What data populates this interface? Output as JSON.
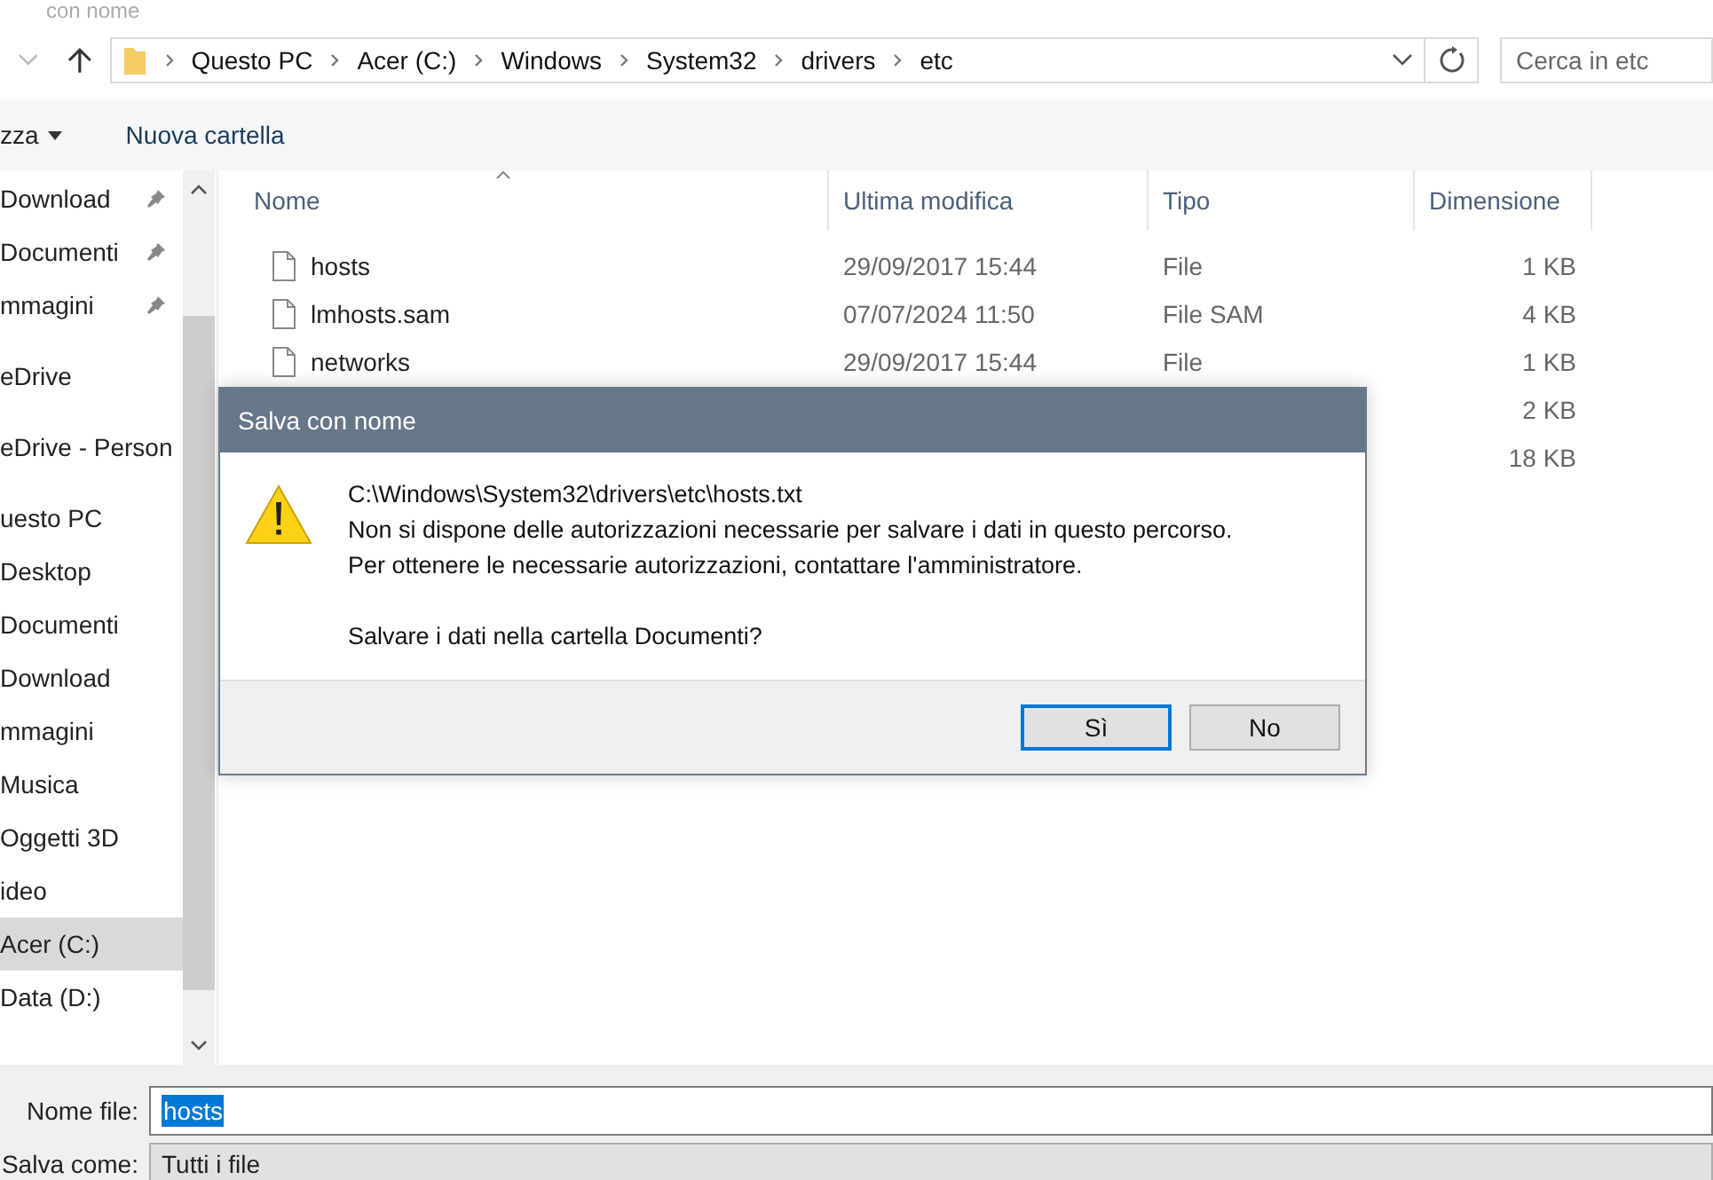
{
  "window": {
    "title": "con nome"
  },
  "address_bar": {
    "crumbs": [
      "Questo PC",
      "Acer (C:)",
      "Windows",
      "System32",
      "drivers",
      "etc"
    ]
  },
  "search": {
    "placeholder": "Cerca in etc"
  },
  "toolbar": {
    "items": [
      {
        "label": "zza",
        "kind": "menu"
      },
      {
        "label": "Nuova cartella",
        "kind": "button"
      }
    ]
  },
  "sidebar": {
    "groups": [
      [
        {
          "label": "Download",
          "pinned": true,
          "selected": false
        },
        {
          "label": "Documenti",
          "pinned": true,
          "selected": false
        },
        {
          "label": "mmagini",
          "pinned": true,
          "selected": false
        }
      ],
      [
        {
          "label": "eDrive",
          "pinned": false,
          "selected": false
        }
      ],
      [
        {
          "label": "eDrive - Person",
          "pinned": false,
          "selected": false
        }
      ],
      [
        {
          "label": "uesto PC",
          "pinned": false,
          "selected": false
        },
        {
          "label": "Desktop",
          "pinned": false,
          "selected": false
        },
        {
          "label": "Documenti",
          "pinned": false,
          "selected": false
        },
        {
          "label": "Download",
          "pinned": false,
          "selected": false
        },
        {
          "label": "mmagini",
          "pinned": false,
          "selected": false
        },
        {
          "label": "Musica",
          "pinned": false,
          "selected": false
        },
        {
          "label": "Oggetti 3D",
          "pinned": false,
          "selected": false
        },
        {
          "label": "ideo",
          "pinned": false,
          "selected": false
        },
        {
          "label": "Acer (C:)",
          "pinned": false,
          "selected": true
        },
        {
          "label": "Data (D:)",
          "pinned": false,
          "selected": false
        }
      ]
    ]
  },
  "table": {
    "columns": [
      {
        "label": "Nome",
        "sorted": true
      },
      {
        "label": "Ultima modifica",
        "sorted": false
      },
      {
        "label": "Tipo",
        "sorted": false
      },
      {
        "label": "Dimensione",
        "sorted": false
      }
    ],
    "rows": [
      {
        "name": "hosts",
        "modified": "29/09/2017 15:44",
        "type": "File",
        "size": "1 KB"
      },
      {
        "name": "lmhosts.sam",
        "modified": "07/07/2024 11:50",
        "type": "File SAM",
        "size": "4 KB"
      },
      {
        "name": "networks",
        "modified": "29/09/2017 15:44",
        "type": "File",
        "size": "1 KB"
      },
      {
        "size": "2 KB"
      },
      {
        "size": "18 KB"
      }
    ]
  },
  "dialog": {
    "title": "Salva con nome",
    "lines": [
      "C:\\Windows\\System32\\drivers\\etc\\hosts.txt",
      "Non si dispone delle autorizzazioni necessarie per salvare i dati in questo percorso.",
      "Per ottenere le necessarie autorizzazioni, contattare l'amministratore."
    ],
    "question": "Salvare i dati nella cartella Documenti?",
    "buttons": [
      {
        "label": "Sì",
        "default": true
      },
      {
        "label": "No",
        "default": false
      }
    ]
  },
  "file_name": {
    "label": "Nome file:",
    "value": "hosts",
    "selected": true
  },
  "save_as": {
    "label": "Salva come:",
    "value": "Tutti i file"
  }
}
